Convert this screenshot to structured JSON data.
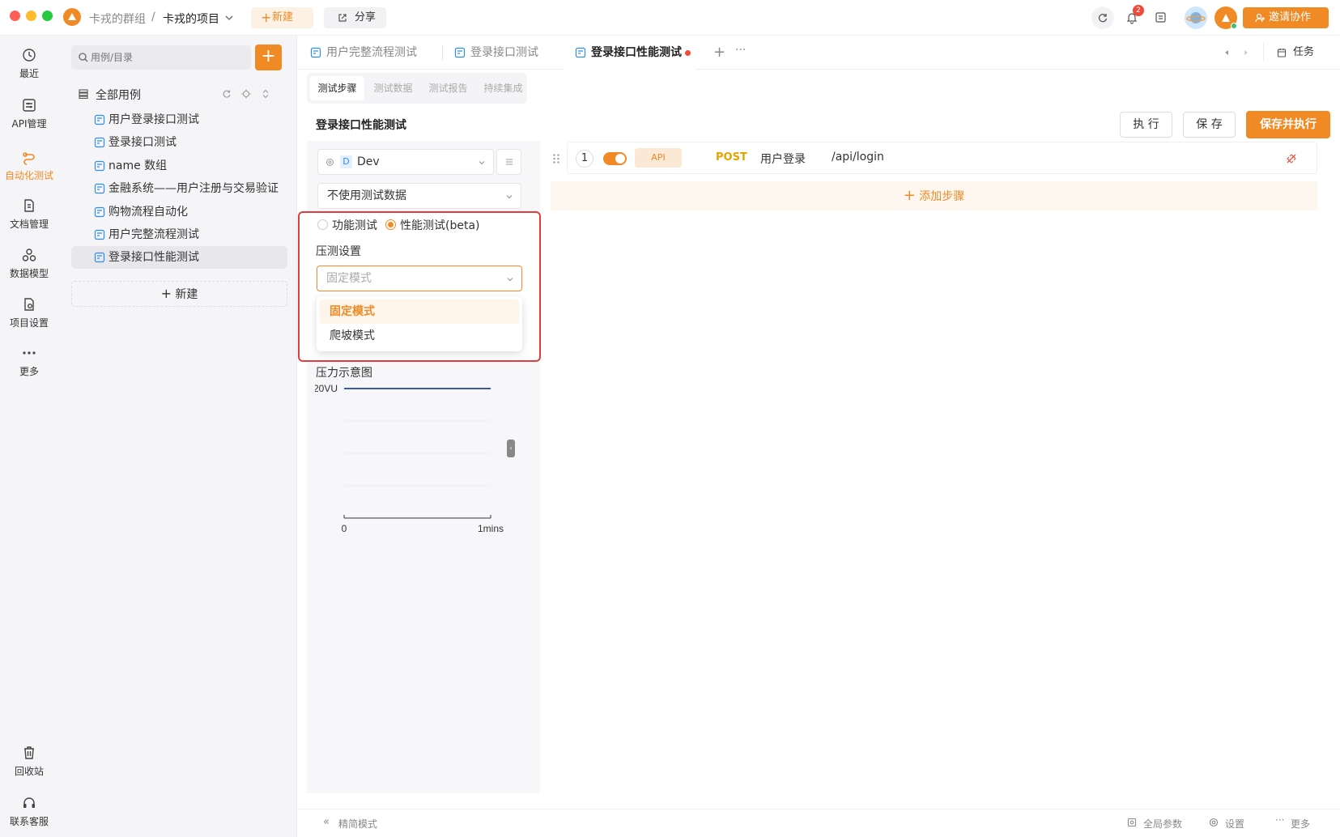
{
  "titlebar": {
    "group": "卡戎的群组",
    "separator": "/",
    "project": "卡戎的项目",
    "new_label": "新建",
    "share_label": "分享",
    "notif_count": "2",
    "invite_label": "邀请协作"
  },
  "leftnav": {
    "items": [
      {
        "label": "最近",
        "icon": "history-icon"
      },
      {
        "label": "API管理",
        "icon": "api-icon"
      },
      {
        "label": "自动化测试",
        "icon": "automation-icon",
        "active": true
      },
      {
        "label": "文档管理",
        "icon": "document-icon"
      },
      {
        "label": "数据模型",
        "icon": "data-model-icon"
      },
      {
        "label": "项目设置",
        "icon": "project-settings-icon"
      },
      {
        "label": "更多",
        "icon": "more-icon"
      }
    ],
    "bottom": [
      {
        "label": "回收站",
        "icon": "trash-icon"
      },
      {
        "label": "联系客服",
        "icon": "headset-icon"
      }
    ]
  },
  "tree": {
    "search_placeholder": "用例/目录",
    "root_label": "全部用例",
    "items": [
      "用户登录接口测试",
      "登录接口测试",
      "name 数组",
      "金融系统——用户注册与交易验证",
      "购物流程自动化",
      "用户完整流程测试",
      "登录接口性能测试"
    ],
    "new_label": "新建"
  },
  "tabs": [
    "用户完整流程测试",
    "登录接口测试",
    "登录接口性能测试"
  ],
  "task_label": "任务",
  "subtabs": [
    "测试步骤",
    "测试数据",
    "测试报告",
    "持续集成"
  ],
  "page_title": "登录接口性能测试",
  "actions": {
    "run": "执 行",
    "save": "保 存",
    "save_run": "保存并执行"
  },
  "config": {
    "env_letter": "D",
    "env_name": "Dev",
    "data_select": "不使用测试数据",
    "radio_func": "功能测试",
    "radio_perf": "性能测试(beta)",
    "pressure_label": "压测设置",
    "mode_placeholder": "固定模式",
    "options": [
      "固定模式",
      "爬坡模式"
    ],
    "chart_title": "压力示意图"
  },
  "chart_data": {
    "type": "line",
    "series": [
      {
        "values": [
          20,
          20
        ]
      }
    ],
    "x": [
      0,
      1
    ],
    "x_tick_labels": [
      "0",
      "1mins"
    ],
    "y_tick_labels": [
      "20VU"
    ],
    "ylim": [
      0,
      20
    ]
  },
  "step": {
    "index": "1",
    "enabled": true,
    "type": "API",
    "method": "POST",
    "name": "用户登录",
    "path": "/api/login"
  },
  "add_step_label": "添加步骤",
  "footer": {
    "simple_mode": "精简模式",
    "global_params": "全局参数",
    "settings": "设置",
    "more": "更多"
  },
  "colors": {
    "accent": "#f08a24",
    "highlight": "#e03e3e",
    "method_post": "#e8a300",
    "chart_line": "#3a5ba8"
  }
}
